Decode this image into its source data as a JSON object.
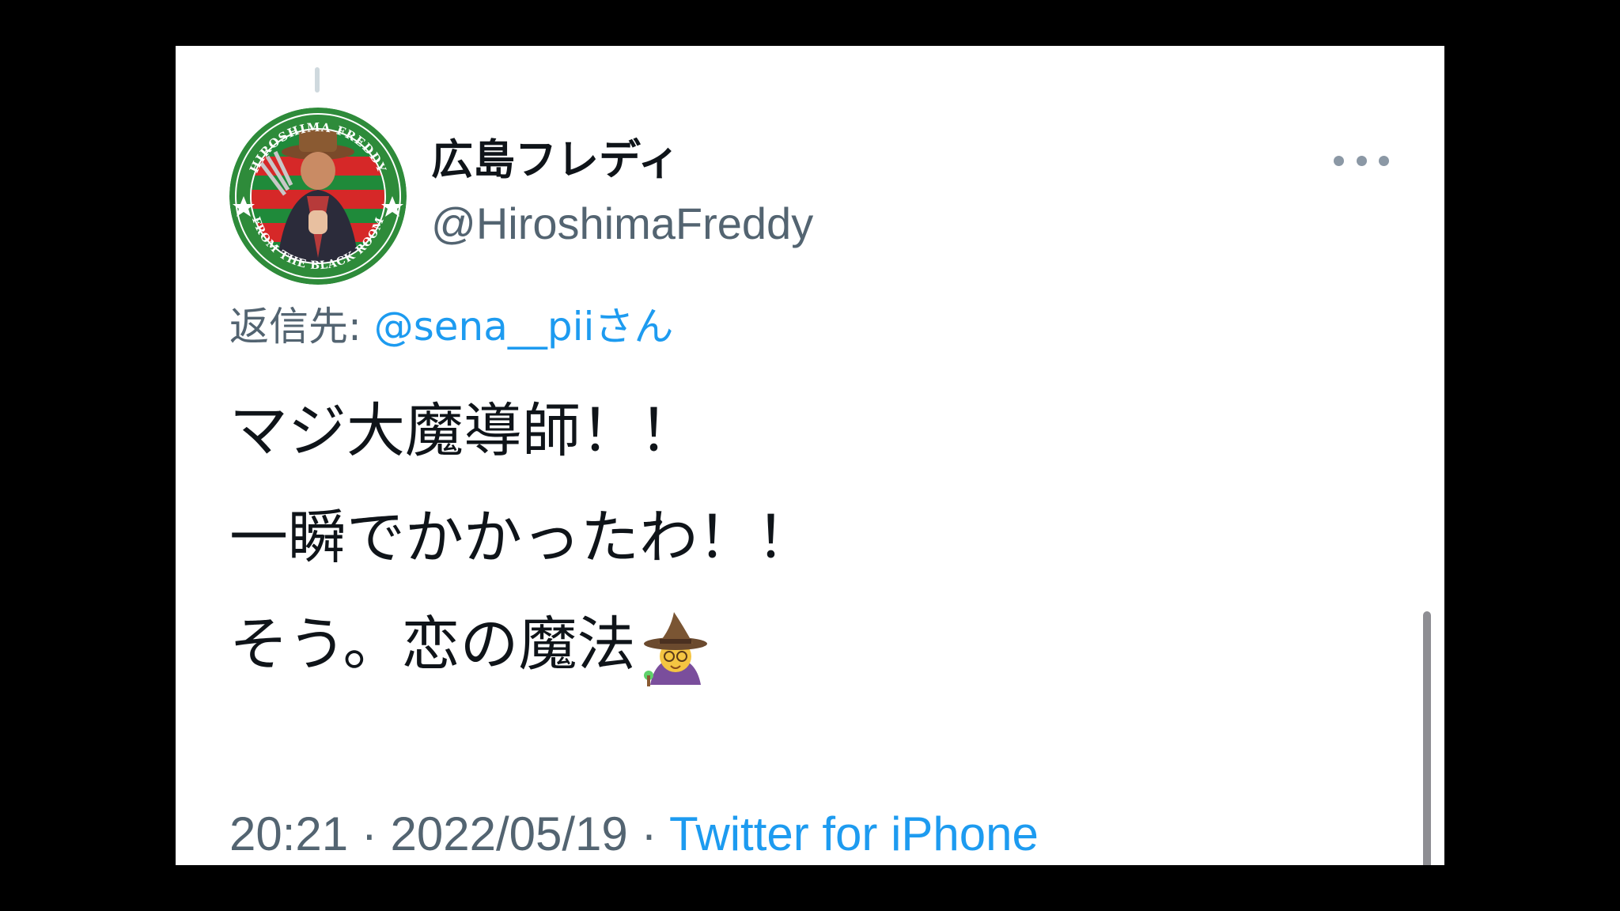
{
  "tweet": {
    "author": {
      "display_name": "広島フレディ",
      "handle": "@HiroshimaFreddy",
      "avatar_text_top": "HIROSHIMA FREDDY",
      "avatar_text_bottom": "FROM THE BLACK ROOM"
    },
    "reply": {
      "prefix": "返信先: ",
      "target": "@sena__piiさん"
    },
    "lines": [
      "マジ大魔導師！！",
      "一瞬でかかったわ！！",
      "そう。恋の魔法"
    ],
    "emoji": "mage-emoji",
    "meta": {
      "time": "20:21",
      "separator": " · ",
      "date": "2022/05/19",
      "source": "Twitter for iPhone"
    }
  },
  "colors": {
    "background": "#ffffff",
    "text": "#0f1419",
    "muted": "#536471",
    "link": "#1d9bf0",
    "letterbox": "#000000"
  },
  "icons": {
    "more": "more-options-icon"
  }
}
